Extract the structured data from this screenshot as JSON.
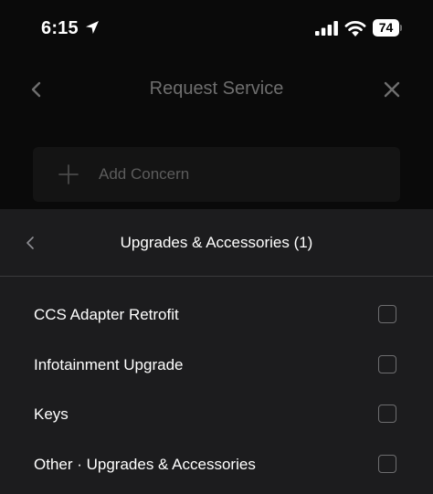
{
  "status_bar": {
    "time": "6:15",
    "battery_level": "74",
    "icons": [
      "location-arrow-icon",
      "cellular-signal-icon",
      "wifi-icon",
      "battery-icon"
    ]
  },
  "background_page": {
    "title": "Request Service",
    "add_concern_label": "Add Concern",
    "icons": [
      "chevron-left-icon",
      "close-icon",
      "plus-icon"
    ]
  },
  "sheet": {
    "title": "Upgrades & Accessories (1)",
    "options": [
      {
        "label": "CCS Adapter Retrofit",
        "checked": false
      },
      {
        "label": "Infotainment Upgrade",
        "checked": false
      },
      {
        "label": "Keys",
        "checked": false
      },
      {
        "label": "Other · Upgrades & Accessories",
        "checked": false
      }
    ]
  },
  "colors": {
    "page_background": "#0a0a0a",
    "sheet_background": "#1c1c1e",
    "divider": "#3a3a3c",
    "dimmed_text": "#6e6e6e",
    "checkbox_border": "#6e6e70"
  }
}
